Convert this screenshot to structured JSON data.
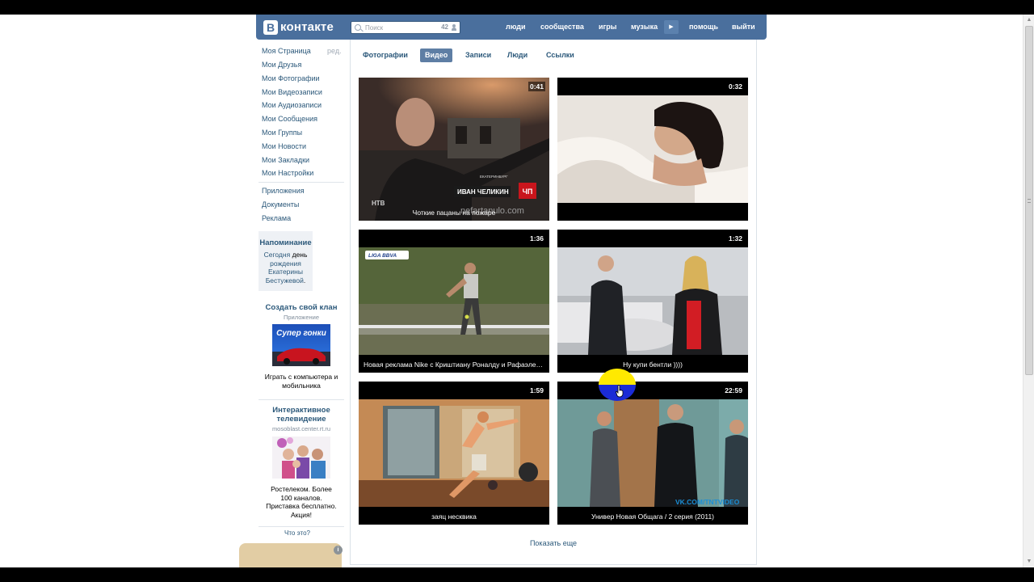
{
  "header": {
    "logo_letter": "В",
    "logo_text": "контакте",
    "search_placeholder": "Поиск",
    "search_count": "42",
    "nav": [
      "люди",
      "сообщества",
      "игры",
      "музыка",
      "помощь",
      "выйти"
    ]
  },
  "sidebar": {
    "menu": [
      "Моя Страница",
      "Мои Друзья",
      "Мои Фотографии",
      "Мои Видеозаписи",
      "Мои Аудиозаписи",
      "Мои Сообщения",
      "Мои Группы",
      "Мои Новости",
      "Мои Закладки",
      "Мои Настройки"
    ],
    "edit_label": "ред.",
    "extra": [
      "Приложения",
      "Документы",
      "Реклама"
    ],
    "reminder": {
      "title": "Напоминание",
      "line1": "Сегодня",
      "line1_plain": "день",
      "line2": "рождения",
      "line3": "Екатерины",
      "line4": "Бестужевой",
      "line4_plain": "."
    },
    "ad1": {
      "title": "Создать свой клан",
      "subtitle": "Приложение",
      "image_text": "Супер гонки",
      "text": "Играть с компьютера и мобильника"
    },
    "ad2": {
      "title": "Интерактивное телевидение",
      "subtitle": "mosoblast.center.rt.ru",
      "text": "Ростелеком. Более 100 каналов. Приставка бесплатно. Акция!"
    },
    "what_link": "Что это?"
  },
  "tabs": [
    "Фотографии",
    "Видео",
    "Записи",
    "Люди",
    "Ссылки"
  ],
  "active_tab": "Видео",
  "videos": [
    {
      "duration": "0:41",
      "title": "Чоткие пацаны на пожаре",
      "overlay_name": "ИВАН ЧЕЛИКИН",
      "overlay_city": "ЕКАТЕРИНБУРГ",
      "watermark": "nefartanulo.com"
    },
    {
      "duration": "0:32",
      "title": ""
    },
    {
      "duration": "1:36",
      "title": "Новая реклама Nike с Криштиану Роналду и Рафаэлем Надалем",
      "badge": "LIGA BBVA"
    },
    {
      "duration": "1:32",
      "title": "Ну купи бентли ))))"
    },
    {
      "duration": "1:59",
      "title": "заяц несквика"
    },
    {
      "duration": "22:59",
      "title": "Универ Новая Общага / 2 серия (2011)",
      "watermark": "VK.COM/TNTVIDEO"
    }
  ],
  "show_more": "Показать еще"
}
